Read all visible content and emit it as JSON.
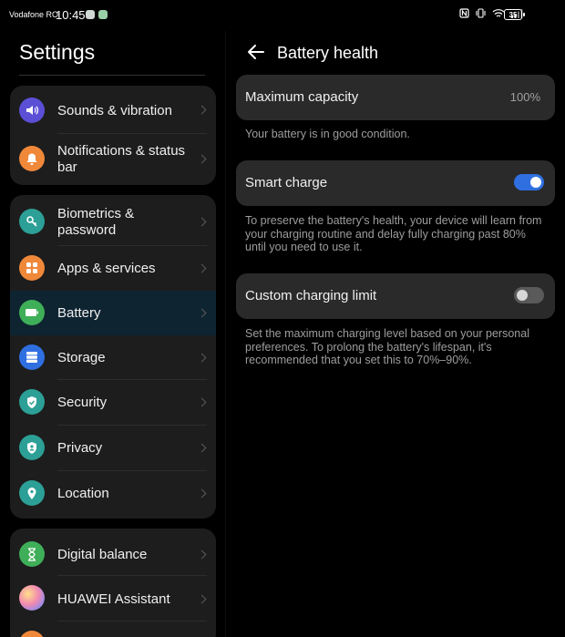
{
  "status_bar": {
    "carrier": "Vodafone RO",
    "time": "10:45",
    "battery_level": "35",
    "icons": [
      "nfc-icon",
      "vibrate-icon",
      "wifi-icon",
      "signal-icon"
    ]
  },
  "left": {
    "title": "Settings",
    "groups": [
      {
        "items": [
          {
            "label": "Sounds & vibration",
            "icon": "speaker-icon",
            "color": "#5b4fd6"
          },
          {
            "label": "Notifications & status bar",
            "icon": "bell-icon",
            "color": "#f0883a"
          }
        ]
      },
      {
        "items": [
          {
            "label": "Biometrics & password",
            "icon": "key-icon",
            "color": "#2c9f96"
          },
          {
            "label": "Apps & services",
            "icon": "apps-icon",
            "color": "#f0883a"
          },
          {
            "label": "Battery",
            "icon": "battery-icon",
            "color": "#3fae58",
            "selected": true
          },
          {
            "label": "Storage",
            "icon": "storage-icon",
            "color": "#2f6fe0"
          },
          {
            "label": "Security",
            "icon": "shield-check-icon",
            "color": "#2c9f96"
          },
          {
            "label": "Privacy",
            "icon": "privacy-shield-icon",
            "color": "#2c9f96"
          },
          {
            "label": "Location",
            "icon": "location-pin-icon",
            "color": "#2c9f96"
          }
        ]
      },
      {
        "items": [
          {
            "label": "Digital balance",
            "icon": "hourglass-icon",
            "color": "#3fae58"
          },
          {
            "label": "HUAWEI Assistant",
            "icon": "assistant-icon",
            "color": "#c77ad6"
          }
        ]
      }
    ]
  },
  "right": {
    "title": "Battery health",
    "max_capacity": {
      "label": "Maximum capacity",
      "value": "100%"
    },
    "max_capacity_hint": "Your battery is in good condition.",
    "smart_charge": {
      "label": "Smart charge",
      "on": true
    },
    "smart_charge_hint": "To preserve the battery's health, your device will learn from your charging routine and delay fully charging past 80% until you need to use it.",
    "custom_limit": {
      "label": "Custom charging limit",
      "on": false
    },
    "custom_limit_hint": "Set the maximum charging level based on your personal preferences. To prolong the battery's lifespan, it's recommended that you set this to 70%–90%."
  }
}
